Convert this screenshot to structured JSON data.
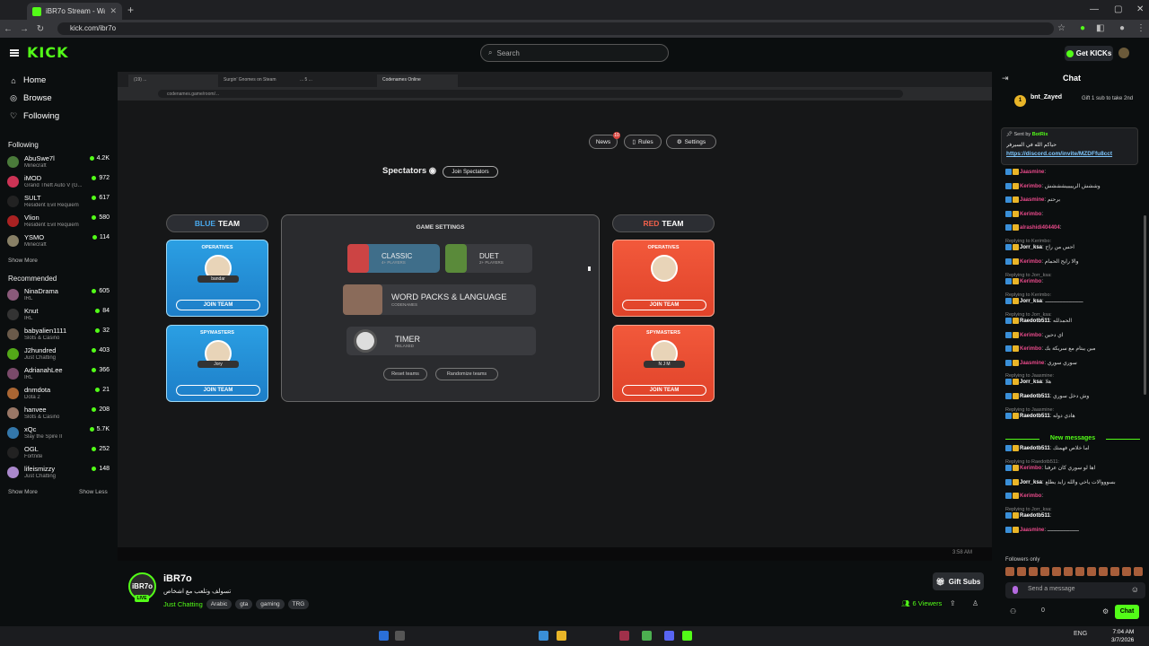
{
  "browser": {
    "tab_title": "iBR7o Stream - Watch Live on K",
    "url": "kick.com/ibr7o"
  },
  "header": {
    "logo": "KICK",
    "search_placeholder": "Search",
    "get_kicks": "Get KICKs"
  },
  "sidebar": {
    "nav": [
      {
        "label": "Home",
        "icon": "home-icon"
      },
      {
        "label": "Browse",
        "icon": "compass-icon"
      },
      {
        "label": "Following",
        "icon": "heart-icon"
      }
    ],
    "following_title": "Following",
    "following": [
      {
        "name": "AbuSwe7l",
        "game": "Minecraft",
        "viewers": "4.2K",
        "color": "#4a7a3a"
      },
      {
        "name": "iMOD",
        "game": "Grand Theft Auto V (G...",
        "viewers": "972",
        "color": "#cc3355"
      },
      {
        "name": "SULT",
        "game": "Resident Evil Requiem",
        "viewers": "617",
        "color": "#222222"
      },
      {
        "name": "Vlion",
        "game": "Resident Evil Requiem",
        "viewers": "580",
        "color": "#aa2222"
      },
      {
        "name": "YSMO",
        "game": "Minecraft",
        "viewers": "114",
        "color": "#888066"
      }
    ],
    "show_more": "Show More",
    "recommended_title": "Recommended",
    "recommended": [
      {
        "name": "NinaDrama",
        "game": "IRL",
        "viewers": "605",
        "color": "#8a5a7a"
      },
      {
        "name": "Knut",
        "game": "IRL",
        "viewers": "84",
        "color": "#333333"
      },
      {
        "name": "babyalien1111",
        "game": "Slots & Casino",
        "viewers": "32",
        "color": "#6a5a4a"
      },
      {
        "name": "J2hundred",
        "game": "Just Chatting",
        "viewers": "403",
        "color": "#53a818"
      },
      {
        "name": "AdrianahLee",
        "game": "IRL",
        "viewers": "366",
        "color": "#7a4a6a"
      },
      {
        "name": "dnmdota",
        "game": "Dota 2",
        "viewers": "21",
        "color": "#aa6633"
      },
      {
        "name": "hanvee",
        "game": "Slots & Casino",
        "viewers": "208",
        "color": "#997766"
      },
      {
        "name": "xQc",
        "game": "Slay the Spire II",
        "viewers": "5.7K",
        "color": "#3377aa"
      },
      {
        "name": "OGL",
        "game": "Fortnite",
        "viewers": "252",
        "color": "#222222"
      },
      {
        "name": "lifeismizzy",
        "game": "Just Chatting",
        "viewers": "148",
        "color": "#aa88cc"
      }
    ],
    "show_more2": "Show More",
    "show_less": "Show Less"
  },
  "stream_view": {
    "tabs": [
      "(19) ...",
      "Surgin' Gnomes on Steam",
      "... 5 ...",
      "Codenames Online"
    ],
    "url": "codenames.game/room/...",
    "news": "News",
    "news_badge": "10",
    "rules": "Rules",
    "settings": "Settings",
    "spectators": "Spectators",
    "join_spectators": "Join Spectators",
    "blue_team": {
      "word1": "BLUE",
      "word2": "TEAM"
    },
    "red_team": {
      "word1": "RED",
      "word2": "TEAM"
    },
    "operatives": "OPERATIVES",
    "spymasters": "SPYMASTERS",
    "join_team": "JOIN TEAM",
    "blue_operative": "bandar",
    "blue_spymaster": "Jory",
    "red_spymaster": "N J M",
    "game_settings": "GAME SETTINGS",
    "classic": "CLASSIC",
    "classic_sub": "4+ PLAYERS",
    "duet": "DUET",
    "duet_sub": "2+ PLAYERS",
    "word_packs": "WORD PACKS & LANGUAGE",
    "word_packs_sub": "CODENAMES",
    "timer": "TIMER",
    "timer_sub": "RELAXED",
    "reset_teams": "Reset teams",
    "randomize_teams": "Randomize teams",
    "time": "3:58 AM"
  },
  "channel": {
    "avatar": "iBR7o",
    "live": "LIVE",
    "name": "iBR7o",
    "title": "تسولف وتلعب مع اشخاص",
    "category": "Just Chatting",
    "tags": [
      "Arabic",
      "gta",
      "gaming",
      "TRG"
    ],
    "gift_subs": "Gift Subs",
    "viewers": "6 Viewers"
  },
  "chat": {
    "title": "Chat",
    "gifter_name": "bnt_Zayed",
    "gifter_count": "1",
    "gifter_text": "Gift 1 sub to take 2nd",
    "pinned_by": "Sent by",
    "pinned_bot": "BotRix",
    "pinned_msg": "حياكم الله في السيرفر",
    "pinned_link": "https://discord.com/invite/MZDFfu8cct",
    "messages": [
      {
        "user": "Jaasmine",
        "color": "#e84a8a",
        "text": "",
        "reply": ""
      },
      {
        "user": "Kerimbo",
        "color": "#e84a8a",
        "text": "وششش الريييييشششش",
        "reply": ""
      },
      {
        "user": "Jaasmine",
        "color": "#e84a8a",
        "text": "برحتم",
        "reply": ""
      },
      {
        "user": "Kerimbo",
        "color": "#e84a8a",
        "text": "",
        "reply": ""
      },
      {
        "user": "alrashidi404404",
        "color": "#e84a8a",
        "text": "",
        "reply": ""
      },
      {
        "user": "Jorr_ksa",
        "color": "#ffffff",
        "text": "احس من راح",
        "reply": "Replying to Kerimbo:"
      },
      {
        "user": "Kerimbo",
        "color": "#e84a8a",
        "text": "والا رايح الحمام",
        "reply": ""
      },
      {
        "user": "Kerimbo",
        "color": "#e84a8a",
        "text": "",
        "reply": "Replying to Jorr_ksa:"
      },
      {
        "user": "Jorr_ksa",
        "color": "#ffffff",
        "text": "ــــــــــــــــــــــــ",
        "reply": "Replying to Kerimbo:"
      },
      {
        "user": "Raedotb511",
        "color": "#ffffff",
        "text": "الحمدلله",
        "reply": "Replying to Jorr_ksa:"
      },
      {
        "user": "Kerimbo",
        "color": "#e84a8a",
        "text": "اي دحين",
        "reply": ""
      },
      {
        "user": "Kerimbo",
        "color": "#e84a8a",
        "text": "مين يبتام مع سريكة بك",
        "reply": ""
      },
      {
        "user": "Jaasmine",
        "color": "#e84a8a",
        "text": "سوري سوري",
        "reply": ""
      },
      {
        "user": "Jorr_ksa",
        "color": "#ffffff",
        "text": "هلا",
        "reply": "Replying to Jaasmine:"
      },
      {
        "user": "Raedotb511",
        "color": "#ffffff",
        "text": "وش دخل سوري",
        "reply": ""
      },
      {
        "user": "Raedotb511",
        "color": "#ffffff",
        "text": "هادي دوله",
        "reply": "Replying to Jaasmine:"
      }
    ],
    "new_messages": "New messages",
    "messages2": [
      {
        "user": "Raedotb511",
        "color": "#ffffff",
        "text": "اما خلاص فهمتك",
        "reply": ""
      },
      {
        "user": "Kerimbo",
        "color": "#e84a8a",
        "text": "اها لو سوري كان عرفنا",
        "reply": "Replying to Raedotb511:"
      },
      {
        "user": "Jorr_ksa",
        "color": "#ffffff",
        "text": "بسوووالات ياخي والله زايد يطلع",
        "reply": ""
      },
      {
        "user": "Kerimbo",
        "color": "#e84a8a",
        "text": "",
        "reply": ""
      },
      {
        "user": "Raedotb511",
        "color": "#ffffff",
        "text": "",
        "reply": "Replying to Jorr_ksa:"
      },
      {
        "user": "Jaasmine",
        "color": "#e84a8a",
        "text": "ــــــــــــــــــــ",
        "reply": ""
      }
    ],
    "followers_only": "Followers only",
    "send_placeholder": "Send a message",
    "count": "0",
    "chat_button": "Chat"
  },
  "taskbar": {
    "lang": "ENG",
    "time": "7:04 AM",
    "date": "3/7/2026"
  }
}
